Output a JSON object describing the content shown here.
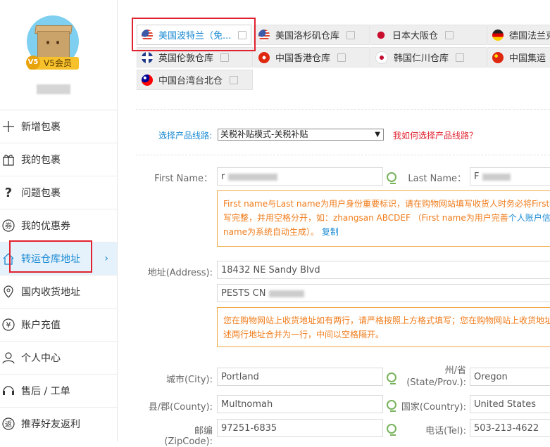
{
  "sidebar": {
    "vip_badge": "V5",
    "vip_label": "V5会员",
    "items": [
      {
        "label": "新增包裹",
        "icon": "plus-icon"
      },
      {
        "label": "我的包裹",
        "icon": "gift-box-icon"
      },
      {
        "label": "问题包裹",
        "icon": "question-icon"
      },
      {
        "label": "我的优惠券",
        "icon": "coupon-icon"
      },
      {
        "label": "转运仓库地址",
        "icon": "house-icon",
        "active": true
      },
      {
        "label": "国内收货地址",
        "icon": "location-pin-icon"
      },
      {
        "label": "账户充值",
        "icon": "yen-icon"
      },
      {
        "label": "个人中心",
        "icon": "person-icon"
      },
      {
        "label": "售后 / 工单",
        "icon": "headset-icon"
      },
      {
        "label": "推荐好友返利",
        "icon": "return-icon"
      }
    ],
    "arrow": "›"
  },
  "tabs": [
    {
      "label": "美国波特兰（免...",
      "flag": "us-flag-icon",
      "active": true
    },
    {
      "label": "美国洛杉矶仓库",
      "flag": "us-flag-icon"
    },
    {
      "label": "日本大阪仓",
      "flag": "jp-flag-icon"
    },
    {
      "label": "德国法兰克",
      "flag": "de-flag-icon"
    },
    {
      "label": "英国伦敦仓库",
      "flag": "uk-flag-icon"
    },
    {
      "label": "中国香港仓库",
      "flag": "hk-flag-icon"
    },
    {
      "label": "韩国仁川仓库",
      "flag": "kr-flag-icon"
    },
    {
      "label": "中国集运",
      "flag": "cn-flag-icon"
    },
    {
      "label": "中国台湾台北仓",
      "flag": "tw-flag-icon"
    }
  ],
  "route": {
    "label": "选择产品线路:",
    "selected": "关税补贴模式-关税补贴",
    "help_link": "我如何选择产品线路？"
  },
  "form": {
    "first_name_label": "First Name：",
    "first_name_value": "r",
    "last_name_label": "Last Name：",
    "last_name_value": "F",
    "name_notice_1": "First name与Last name为用户身份重要标识，请在购物网站填写收货人时务必将First n",
    "name_notice_2_a": "写完整，并用空格分开，如：zhangsan ABCDEF （First name为用户完善",
    "name_notice_2_link": "个人账户信息",
    "name_notice_3": "name为系统自动生成）。",
    "name_notice_copy": "复制",
    "address_label": "地址(Address):",
    "address_line1": "18432 NE Sandy Blvd",
    "address_line2": "PESTS CN",
    "address_notice_1": "您在购物网站上收货地址如有两行，请严格按照上方格式填写；您在购物网站上收货地址",
    "address_notice_2": "述两行地址合并为一行，中间以空格隔开。",
    "city_label": "城市(City):",
    "city_value": "Portland",
    "state_label_1": "州/省",
    "state_label_2": "(State/Prov.):",
    "state_value": "Oregon",
    "county_label": "县/郡(County):",
    "county_value": "Multnomah",
    "country_label": "国家(Country):",
    "country_value": "United States",
    "zip_label": "邮编 (ZipCode):",
    "zip_value": "97251-6835",
    "phone_label": "电话(Tel):",
    "phone_value": "503-213-4622"
  },
  "colors": {
    "accent": "#1a8ad3",
    "notice_border": "#f0a843",
    "notice_text": "#f07c1b",
    "highlight_box": "#e0222f",
    "vip": "#f6c12b"
  }
}
